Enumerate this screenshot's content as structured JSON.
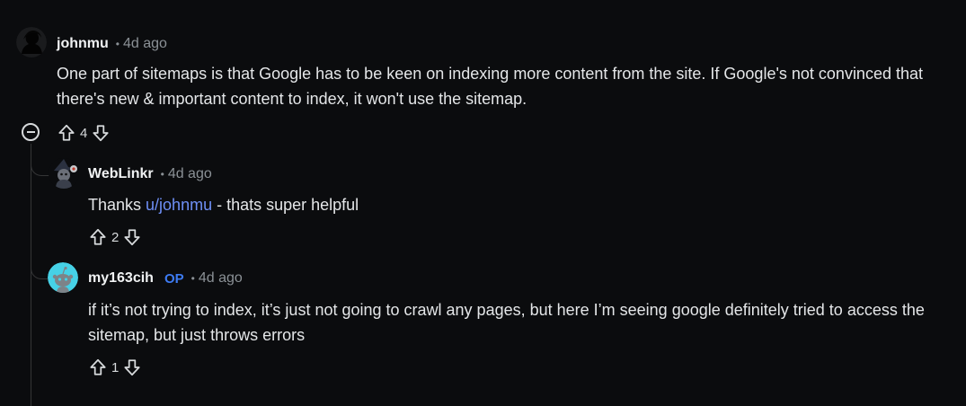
{
  "comments": [
    {
      "username": "johnmu",
      "separator": "•",
      "time": "4d ago",
      "body": "One part of sitemaps is that Google has to be keen on indexing more content from the site. If Google's not convinced that there's new & important content to index, it won't use the sitemap.",
      "score": "4",
      "avatar_icon": "user-silhouette-icon"
    },
    {
      "username": "WebLinkr",
      "separator": "•",
      "time": "4d ago",
      "body_prefix": "Thanks ",
      "body_link": "u/johnmu",
      "body_suffix": " - thats super helpful",
      "score": "2",
      "avatar_icon": "wizard-avatar-icon"
    },
    {
      "username": "my163cih",
      "op_badge": "OP",
      "separator": "•",
      "time": "4d ago",
      "body": "if it’s not trying to index, it’s just not going to crawl any pages, but here I’m seeing google definitely tried to access the sitemap, but just throws errors",
      "score": "1",
      "avatar_icon": "snoo-avatar-icon"
    }
  ],
  "colors": {
    "background": "#0b0c0e",
    "text": "#e4e6e8",
    "muted": "#8b9196",
    "link": "#6e8ff5",
    "op": "#3d7bf3",
    "snoo_bg": "#46d1e6"
  }
}
